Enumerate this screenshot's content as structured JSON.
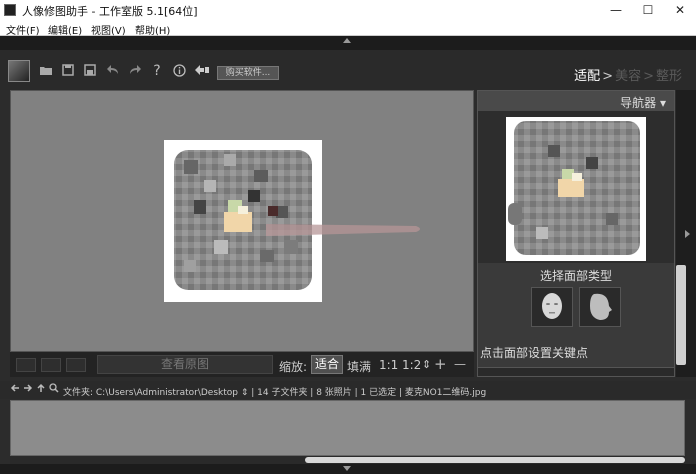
{
  "window": {
    "title": "人像修图助手 - 工作室版 5.1[64位]",
    "minimize_icon": "—",
    "maximize_icon": "☐",
    "close_icon": "✕"
  },
  "menu": [
    "文件(F)",
    "编辑(E)",
    "视图(V)",
    "帮助(H)"
  ],
  "toolbar": {
    "icons": [
      "logo-icon",
      "open-folder-icon",
      "save-icon",
      "save-as-icon",
      "undo-icon",
      "redo-icon",
      "help-icon",
      "info-icon",
      "plugin-icon"
    ],
    "help_glyph": "?",
    "buy_label": "购买软件..."
  },
  "mode_tabs": {
    "active": "适配",
    "sep": ">",
    "tab2": "美容",
    "tab3": "整形"
  },
  "canvas": {
    "background": "#818181"
  },
  "bottom_bar": {
    "view_original": "查看原图",
    "zoom_label": "缩放:",
    "zoom_fit": "适合",
    "zoom_fill": "填满",
    "zoom_1_1": "1:1",
    "zoom_1_2": "1:2",
    "zoom_in": "+",
    "zoom_out": "—",
    "stepper": "⇕"
  },
  "right_panel": {
    "navigator_title": "导航器 ▾",
    "face_type_label": "选择面部类型",
    "keypoint_label": "点击面部设置关键点"
  },
  "path_bar": {
    "path_text": "文件夹: C:\\Users\\Administrator\\Desktop ⇕ | 14 子文件夹 | 8 张照片 | 1 已选定 | 麦克NO1二维码.jpg"
  },
  "colors": {
    "accent_text": "#ffffff",
    "dim_tab": "#5a5a5a"
  }
}
